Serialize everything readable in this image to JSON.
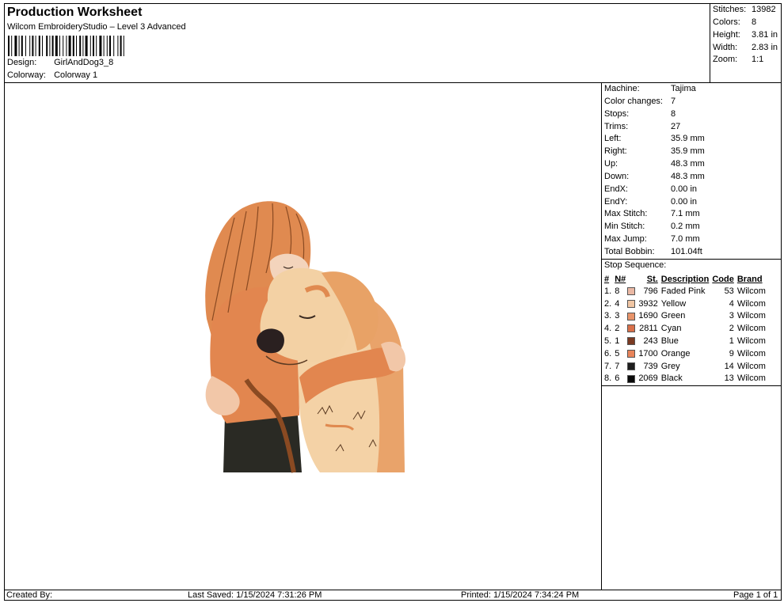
{
  "header": {
    "title": "Production Worksheet",
    "subtitle": "Wilcom EmbroideryStudio – Level 3 Advanced",
    "design_label": "Design:",
    "design_value": "GirlAndDog3_8",
    "colorway_label": "Colorway:",
    "colorway_value": "Colorway 1"
  },
  "summary": [
    {
      "label": "Stitches:",
      "value": "13982"
    },
    {
      "label": "Colors:",
      "value": "8"
    },
    {
      "label": "Height:",
      "value": "3.81 in"
    },
    {
      "label": "Width:",
      "value": "2.83 in"
    },
    {
      "label": "Zoom:",
      "value": "1:1"
    }
  ],
  "machine_info": [
    {
      "label": "Machine:",
      "value": "Tajima"
    },
    {
      "label": "Color changes:",
      "value": "7"
    },
    {
      "label": "Stops:",
      "value": "8"
    },
    {
      "label": "Trims:",
      "value": "27"
    },
    {
      "label": "Left:",
      "value": "35.9 mm"
    },
    {
      "label": "Right:",
      "value": "35.9 mm"
    },
    {
      "label": "Up:",
      "value": "48.3 mm"
    },
    {
      "label": "Down:",
      "value": "48.3 mm"
    },
    {
      "label": "EndX:",
      "value": "0.00 in"
    },
    {
      "label": "EndY:",
      "value": "0.00 in"
    },
    {
      "label": "Max Stitch:",
      "value": "7.1 mm"
    },
    {
      "label": "Min Stitch:",
      "value": "0.2 mm"
    },
    {
      "label": "Max Jump:",
      "value": "7.0 mm"
    },
    {
      "label": "Total Bobbin:",
      "value": "101.04ft"
    }
  ],
  "stop_sequence": {
    "title": "Stop Sequence:",
    "columns": {
      "index": "#",
      "needle": "N#",
      "stitches": "St.",
      "description": "Description",
      "code": "Code",
      "brand": "Brand"
    },
    "rows": [
      {
        "index": "1.",
        "needle": "8",
        "color": "#eab8a4",
        "stitches": "796",
        "description": "Faded Pink",
        "code": "53",
        "brand": "Wilcom"
      },
      {
        "index": "2.",
        "needle": "4",
        "color": "#f0c6a4",
        "stitches": "3932",
        "description": "Yellow",
        "code": "4",
        "brand": "Wilcom"
      },
      {
        "index": "3.",
        "needle": "3",
        "color": "#e8946a",
        "stitches": "1690",
        "description": "Green",
        "code": "3",
        "brand": "Wilcom"
      },
      {
        "index": "4.",
        "needle": "2",
        "color": "#d9704a",
        "stitches": "2811",
        "description": "Cyan",
        "code": "2",
        "brand": "Wilcom"
      },
      {
        "index": "5.",
        "needle": "1",
        "color": "#7a3a22",
        "stitches": "243",
        "description": "Blue",
        "code": "1",
        "brand": "Wilcom"
      },
      {
        "index": "6.",
        "needle": "5",
        "color": "#e8845a",
        "stitches": "1700",
        "description": "Orange",
        "code": "9",
        "brand": "Wilcom"
      },
      {
        "index": "7.",
        "needle": "7",
        "color": "#1e1e1e",
        "stitches": "739",
        "description": "Grey",
        "code": "14",
        "brand": "Wilcom"
      },
      {
        "index": "8.",
        "needle": "6",
        "color": "#0a0a0a",
        "stitches": "2069",
        "description": "Black",
        "code": "13",
        "brand": "Wilcom"
      }
    ]
  },
  "footer": {
    "created_by": "Created By:",
    "last_saved": "Last Saved: 1/15/2024 7:31:26 PM",
    "printed": "Printed: 1/15/2024 7:34:24 PM",
    "page": "Page 1 of 1"
  }
}
